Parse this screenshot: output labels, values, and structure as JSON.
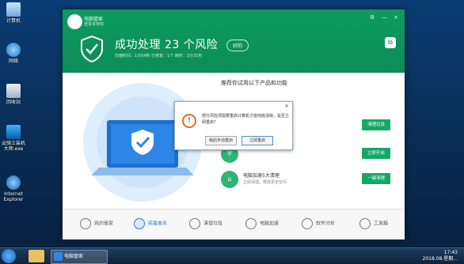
{
  "desktop": {
    "icons": [
      {
        "label": "计算机"
      },
      {
        "label": "网络"
      },
      {
        "label": "回收站"
      },
      {
        "label": "云骑士装机大师.exe"
      },
      {
        "label": "Internet Explorer"
      }
    ]
  },
  "window": {
    "user_name": "电脑管家",
    "user_sub": "登录享特权",
    "controls": [
      "⚙",
      "—",
      "×"
    ],
    "headline": "成功处理 23 个风险",
    "headline_badge": "好的",
    "subline": "扫描时间：1分04秒   已修复：1个   耗时：2分31秒",
    "expand_icon": "expand-icon"
  },
  "recommend": {
    "title": "推荐你试用以下产品和功能",
    "rows": [
      {
        "title": "",
        "desc": "",
        "button": "清理垃圾"
      },
      {
        "title": "",
        "desc": "",
        "button": "立即开启"
      },
      {
        "title": "电脑加速5大清理",
        "desc": "立即清理，释放更多空间",
        "button": "一键清理"
      }
    ]
  },
  "dialog": {
    "message": "部分风险项需要重启计算机才能彻底清除，是否立即重启？",
    "btn_manual": "稍后手动重启",
    "btn_restart": "立即重启"
  },
  "nav": {
    "items": [
      "我的管家",
      "病毒查杀",
      "清理垃圾",
      "电脑加速",
      "软件分析",
      "工具箱"
    ],
    "active": 1
  },
  "taskbar": {
    "app_label": "电脑管家",
    "time": "17:43",
    "date": "2018.08.星期..."
  },
  "colors": {
    "header_green": "#0e9a5f",
    "button_green": "#13a868",
    "warn_orange": "#e06d1f"
  }
}
